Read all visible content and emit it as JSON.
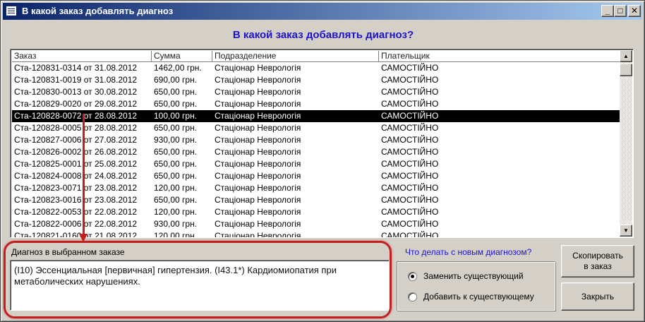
{
  "window": {
    "title": "В какой заказ добавлять диагноз",
    "icon": "window-icon",
    "controls": {
      "minimize": "_",
      "maximize": "□",
      "close": "✕"
    }
  },
  "heading": "В какой заказ добавлять диагноз?",
  "table": {
    "columns": [
      "Заказ",
      "Сумма",
      "Подразделение",
      "Плательщик"
    ],
    "selected_row": 4,
    "rows": [
      [
        "Ста-120831-0314 от 31.08.2012",
        "1462,00 грн.",
        "Стаціонар Неврологія",
        "САМОСТІЙНО"
      ],
      [
        "Ста-120831-0019 от 31.08.2012",
        "690,00 грн.",
        "Стаціонар Неврологія",
        "САМОСТІЙНО"
      ],
      [
        "Ста-120830-0013 от 30.08.2012",
        "650,00 грн.",
        "Стаціонар Неврологія",
        "САМОСТІЙНО"
      ],
      [
        "Ста-120829-0020 от 29.08.2012",
        "650,00 грн.",
        "Стаціонар Неврологія",
        "САМОСТІЙНО"
      ],
      [
        "Ста-120828-0072 от 28.08.2012",
        "100,00 грн.",
        "Стаціонар Неврологія",
        "САМОСТІЙНО"
      ],
      [
        "Ста-120828-0005 от 28.08.2012",
        "650,00 грн.",
        "Стаціонар Неврологія",
        "САМОСТІЙНО"
      ],
      [
        "Ста-120827-0006 от 27.08.2012",
        "930,00 грн.",
        "Стаціонар Неврологія",
        "САМОСТІЙНО"
      ],
      [
        "Ста-120826-0002 от 26.08.2012",
        "650,00 грн.",
        "Стаціонар Неврологія",
        "САМОСТІЙНО"
      ],
      [
        "Ста-120825-0001 от 25.08.2012",
        "650,00 грн.",
        "Стаціонар Неврологія",
        "САМОСТІЙНО"
      ],
      [
        "Ста-120824-0008 от 24.08.2012",
        "650,00 грн.",
        "Стаціонар Неврологія",
        "САМОСТІЙНО"
      ],
      [
        "Ста-120823-0071 от 23.08.2012",
        "120,00 грн.",
        "Стаціонар Неврологія",
        "САМОСТІЙНО"
      ],
      [
        "Ста-120823-0016 от 23.08.2012",
        "650,00 грн.",
        "Стаціонар Неврологія",
        "САМОСТІЙНО"
      ],
      [
        "Ста-120822-0053 от 22.08.2012",
        "120,00 грн.",
        "Стаціонар Неврологія",
        "САМОСТІЙНО"
      ],
      [
        "Ста-120822-0006 от 22.08.2012",
        "930,00 грн.",
        "Стаціонар Неврологія",
        "САМОСТІЙНО"
      ],
      [
        "Ста-120821-0160 от 21.08.2012",
        "120,00 грн.",
        "Стаціонар Неврологія",
        "САМОСТІЙНО"
      ]
    ]
  },
  "diagnosis": {
    "label": "Диагноз в выбранном заказе",
    "text": "(I10) Эссенциальная [первичная] гипертензия. (I43.1*) Кардиомиопатия при метаболических нарушениях."
  },
  "options": {
    "question": "Что делать с новым диагнозом?",
    "selected": 0,
    "items": [
      "Заменить существующий",
      "Добавить к существующему"
    ]
  },
  "buttons": {
    "copy": "Скопировать в заказ",
    "close": "Закрыть"
  },
  "colors": {
    "accent_text": "#1c14c8",
    "highlight": "#c02020",
    "selection": "#000000"
  }
}
